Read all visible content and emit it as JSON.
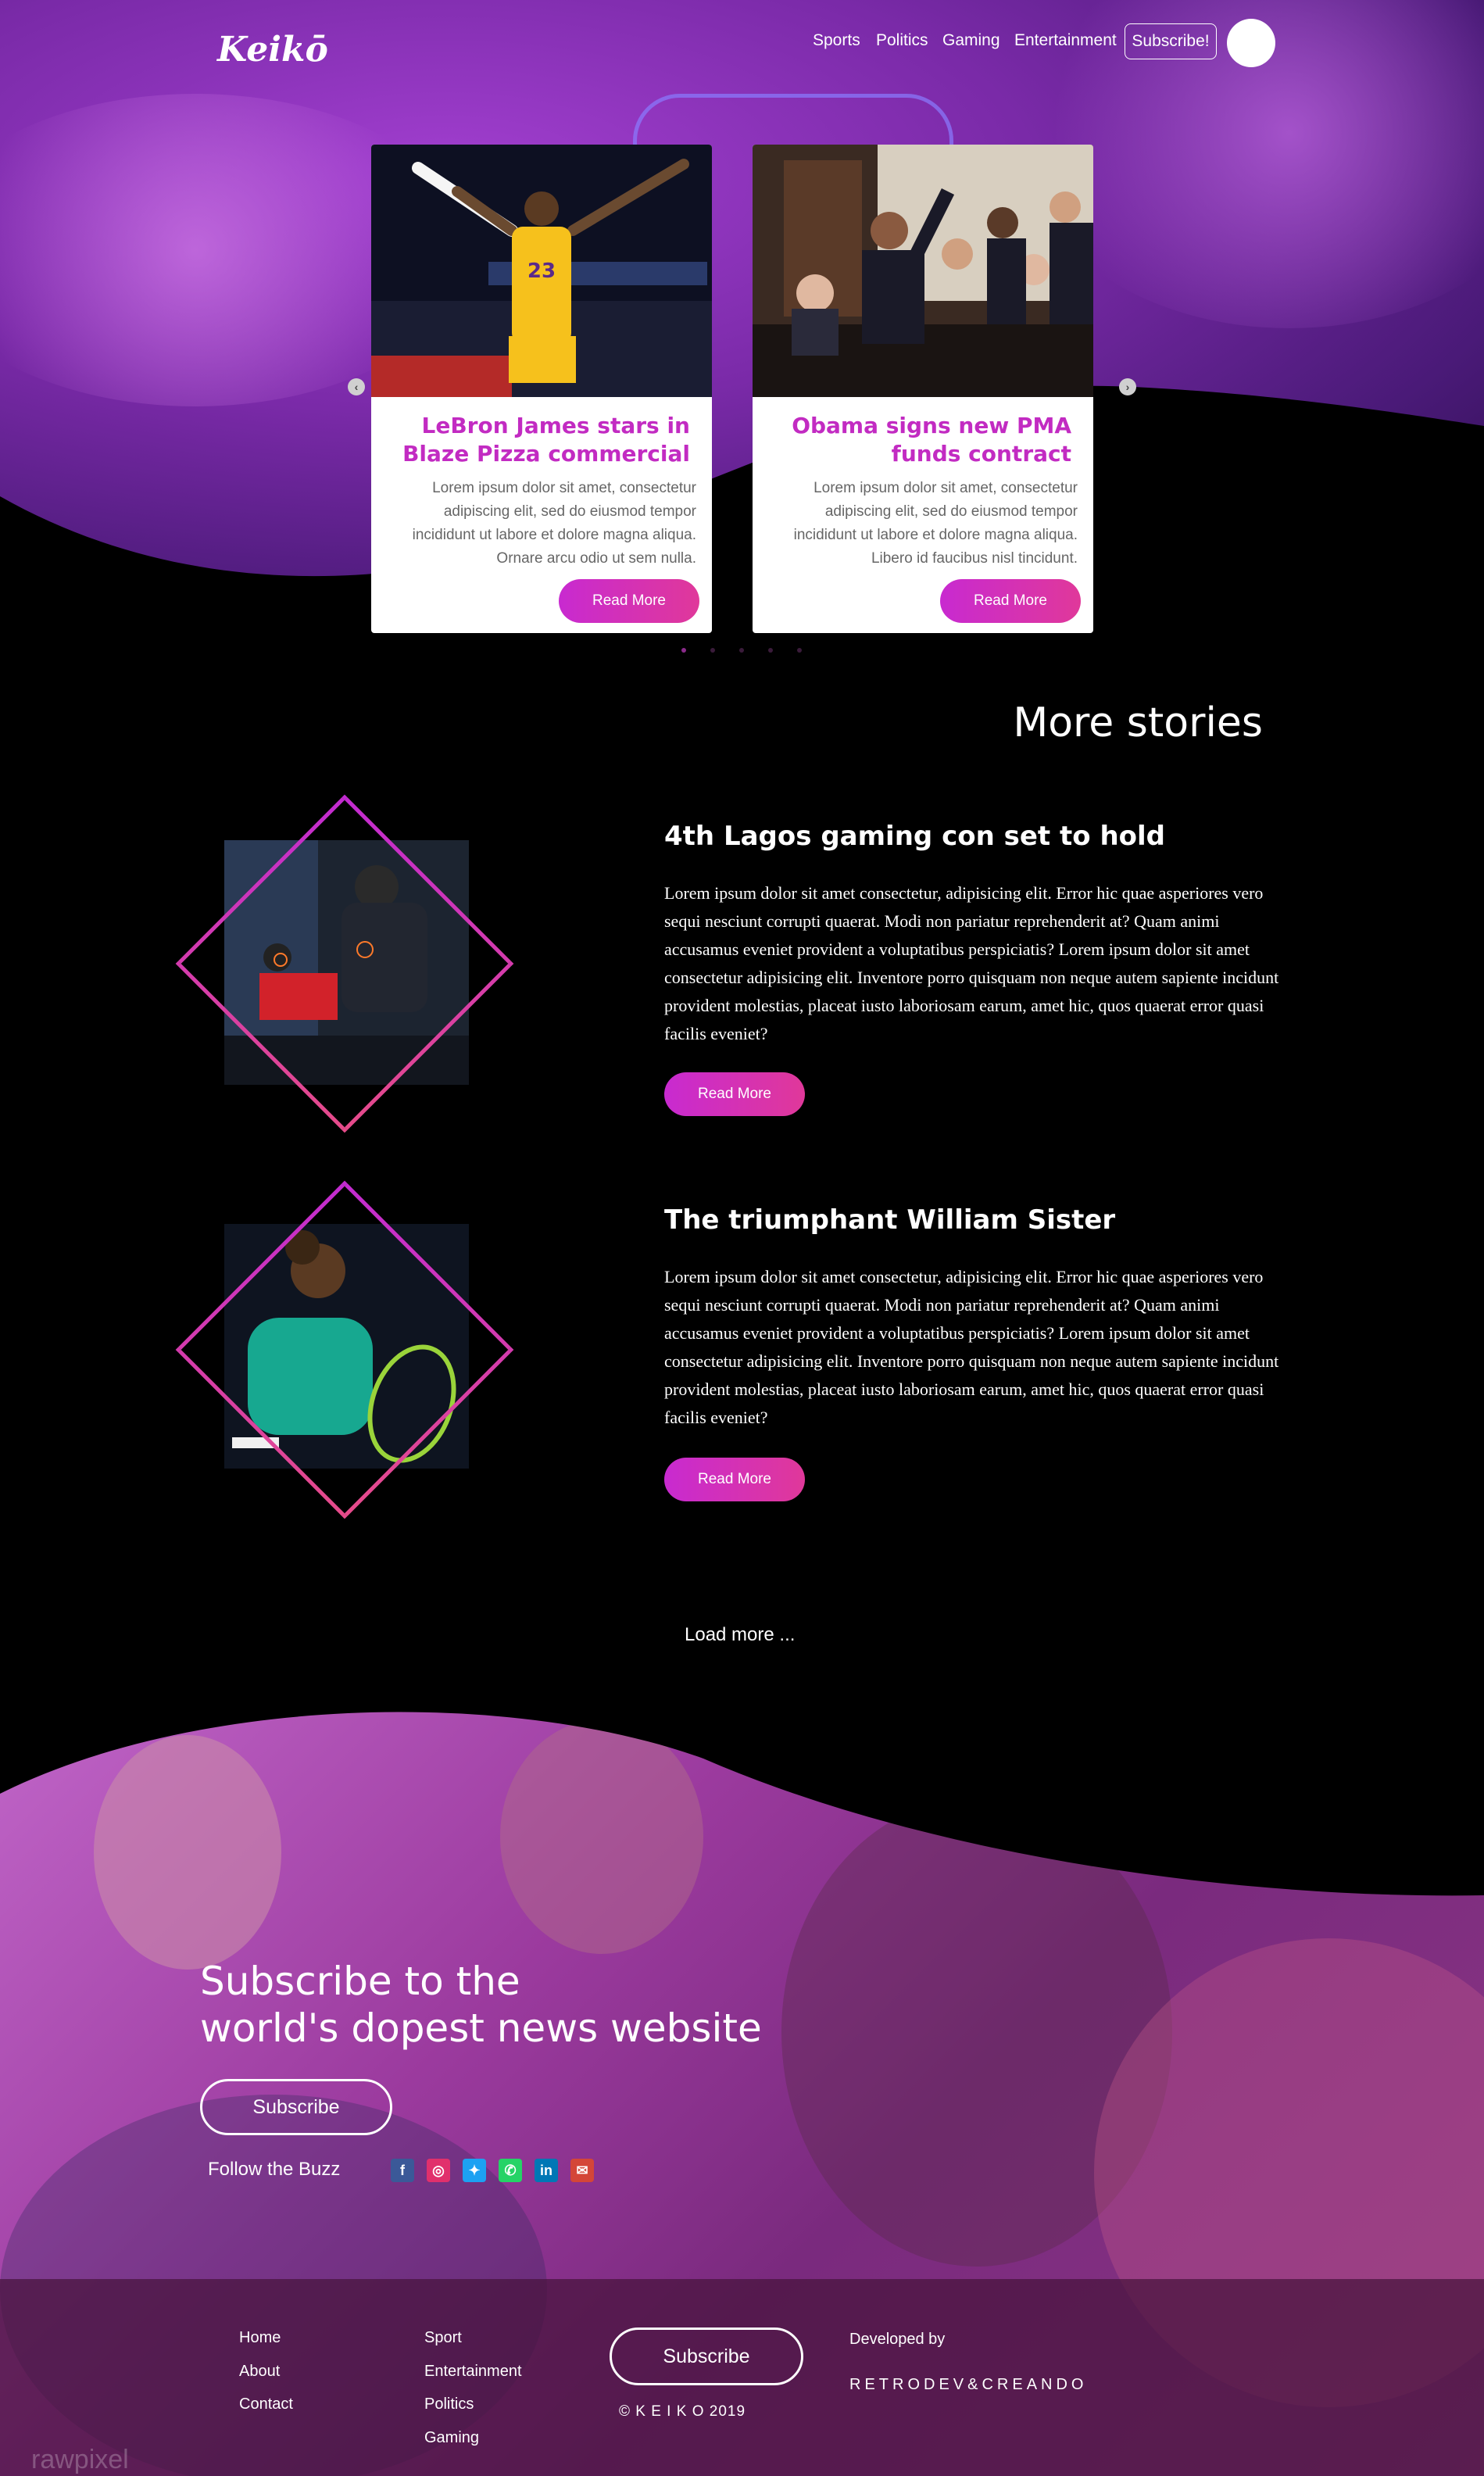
{
  "brand": {
    "logo": "Keikō"
  },
  "nav": {
    "items": [
      "Sports",
      "Politics",
      "Gaming",
      "Entertainment"
    ],
    "subscribe": "Subscribe!"
  },
  "carousel": {
    "prev_icon": "chevron-left-icon",
    "next_icon": "chevron-right-icon",
    "cards": [
      {
        "title": "LeBron James stars in Blaze Pizza commercial",
        "body": "Lorem ipsum dolor sit amet, consectetur adipiscing elit, sed do eiusmod tempor incididunt ut labore et dolore magna aliqua. Ornare arcu odio ut sem nulla.",
        "cta": "Read More"
      },
      {
        "title": "Obama signs new PMA funds contract",
        "body": "Lorem ipsum dolor sit amet, consectetur adipiscing elit, sed do eiusmod tempor incididunt ut labore et dolore magna aliqua. Libero id faucibus nisl tincidunt.",
        "cta": "Read More"
      }
    ],
    "pages": 5,
    "active_page": 1
  },
  "more": {
    "title": "More stories",
    "stories": [
      {
        "title": "4th Lagos gaming con set to hold",
        "body": "Lorem ipsum dolor sit amet consectetur, adipisicing elit. Error hic quae asperiores vero sequi nesciunt corrupti quaerat. Modi non pariatur reprehenderit at? Quam animi accusamus eveniet provident a voluptatibus perspiciatis? Lorem ipsum dolor sit amet consectetur adipisicing elit. Inventore porro quisquam non neque autem sapiente incidunt provident molestias, placeat iusto laboriosam earum, amet hic, quos quaerat error quasi facilis eveniet?",
        "cta": "Read More"
      },
      {
        "title": "The triumphant William Sister",
        "body": "Lorem ipsum dolor sit amet consectetur, adipisicing elit. Error hic quae asperiores vero sequi nesciunt corrupti quaerat. Modi non pariatur reprehenderit at? Quam animi accusamus eveniet provident a voluptatibus perspiciatis? Lorem ipsum dolor sit amet consectetur adipisicing elit. Inventore porro quisquam non neque autem sapiente incidunt provident molestias, placeat iusto laboriosam earum, amet hic, quos quaerat error quasi facilis eveniet?",
        "cta": "Read More"
      }
    ],
    "load_more": "Load more ..."
  },
  "subscribe_section": {
    "title_line1": "Subscribe to the",
    "title_line2": "world's dopest news website",
    "button": "Subscribe",
    "follow": "Follow the Buzz",
    "socials": [
      {
        "icon": "facebook-icon",
        "glyph": "f",
        "color": "#3b5998"
      },
      {
        "icon": "instagram-icon",
        "glyph": "◎",
        "color": "#e1306c"
      },
      {
        "icon": "twitter-icon",
        "glyph": "✦",
        "color": "#1da1f2"
      },
      {
        "icon": "whatsapp-icon",
        "glyph": "✆",
        "color": "#25d366"
      },
      {
        "icon": "linkedin-icon",
        "glyph": "in",
        "color": "#0077b5"
      },
      {
        "icon": "gmail-icon",
        "glyph": "✉",
        "color": "#d44638"
      }
    ]
  },
  "footer": {
    "col1": [
      "Home",
      "About",
      "Contact"
    ],
    "col2": [
      "Sport",
      "Entertainment",
      "Politics",
      "Gaming"
    ],
    "subscribe": "Subscribe",
    "copyright": "© K E I K O 2019",
    "developed_by": "Developed by",
    "developer": "RETRODEV&CREANDO",
    "watermark": "rawpixel"
  },
  "colors": {
    "accent": "#c22bc2",
    "accent2": "#e0389a"
  }
}
